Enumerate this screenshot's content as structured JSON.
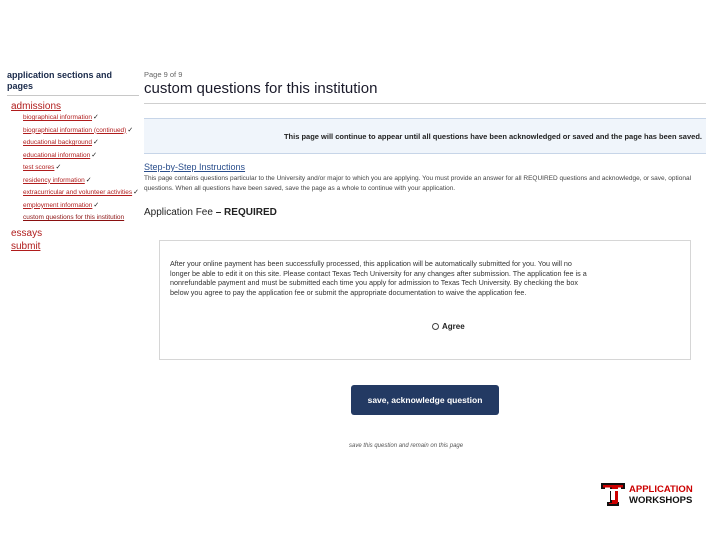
{
  "sidebar": {
    "title": "application sections and pages",
    "sections": [
      {
        "label": "admissions",
        "items": [
          {
            "label": "biographical information",
            "check": "✓"
          },
          {
            "label": "biographical information (continued)",
            "check": "✓"
          },
          {
            "label": "educational background",
            "check": "✓"
          },
          {
            "label": "educational information",
            "check": "✓"
          },
          {
            "label": "test scores",
            "check": "✓"
          },
          {
            "label": "residency information",
            "check": "✓"
          },
          {
            "label": "extracurricular and volunteer activities",
            "check": "✓"
          },
          {
            "label": "employment information",
            "check": "✓"
          },
          {
            "label": "custom questions for this institution",
            "check": ""
          }
        ]
      },
      {
        "label": "essays",
        "items": []
      },
      {
        "label": "submit",
        "items": []
      }
    ]
  },
  "main": {
    "page_indicator": "Page 9 of 9",
    "title": "custom questions for this institution",
    "notice": "This page will continue to appear until all questions have been acknowledged or saved and the page has been saved.",
    "instructions_link": "Step-by-Step Instructions",
    "instructions_text": "This page contains questions particular to the University and/or major to which you are applying. You must provide an answer for all REQUIRED questions and acknowledge, or save, optional questions. When all questions have been saved, save the page as a whole to continue with your application.",
    "question_title": "Application Fee",
    "question_required": " – REQUIRED",
    "question_text": "After your online payment has been successfully processed, this application will be automatically submitted for you. You will no longer be able to edit it on this site. Please contact Texas Tech University for any changes after submission. The application fee is a nonrefundable payment and must be submitted each time you apply for admission to Texas Tech University. By checking the box below you agree to pay the application fee or submit the appropriate documentation to waive the application fee.",
    "agree_label": "Agree",
    "save_button": "save, acknowledge question",
    "save_link": "save this question and remain on this page"
  },
  "logo": {
    "line1": "APPLICATION",
    "line2": "WORKSHOPS",
    "icon": "double-t-logo-icon",
    "colors": {
      "red": "#cc0000",
      "black": "#111111"
    }
  },
  "colors": {
    "nav_red": "#b01c1c",
    "button_navy": "#233a63",
    "link_blue": "#2a4e8c",
    "notice_bg": "#f0f5fb"
  }
}
